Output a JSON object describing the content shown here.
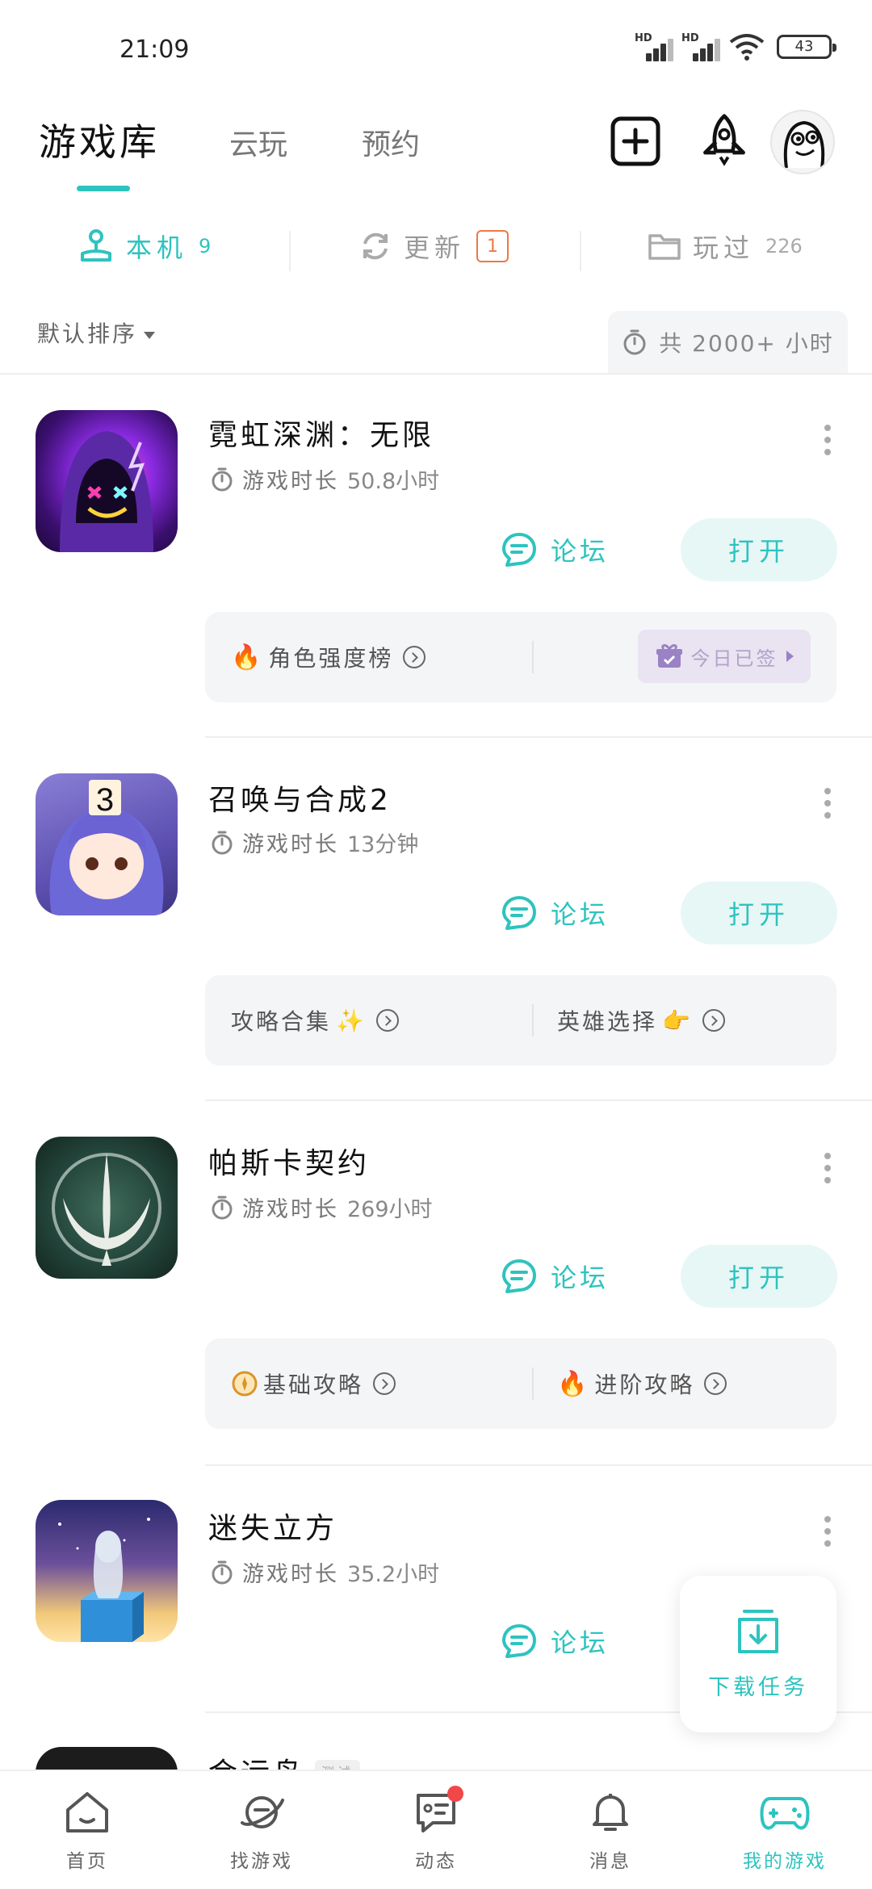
{
  "status_bar": {
    "time": "21:09",
    "battery": "43",
    "signal_label": "HD"
  },
  "top_tabs": [
    {
      "label": "游戏库",
      "active": true
    },
    {
      "label": "云玩",
      "active": false
    },
    {
      "label": "预约",
      "active": false
    }
  ],
  "header_icons": [
    "add-icon",
    "rocket-icon",
    "avatar"
  ],
  "sub_tabs": [
    {
      "label": "本机",
      "count": "9",
      "icon": "joystick-icon",
      "active": true
    },
    {
      "label": "更新",
      "count": "1",
      "icon": "refresh-icon",
      "active": false
    },
    {
      "label": "玩过",
      "count": "226",
      "icon": "folder-icon",
      "active": false
    }
  ],
  "sort": {
    "label": "默认排序"
  },
  "total_time": {
    "text": "共 2000+ 小时"
  },
  "games": [
    {
      "title": "霓虹深渊：无限",
      "time_label": "游戏时长",
      "time_value": "50.8小时",
      "forum_label": "论坛",
      "open_label": "打开",
      "tips": [
        "角色强度榜"
      ],
      "signin_label": "今日已签"
    },
    {
      "title": "召唤与合成2",
      "time_label": "游戏时长",
      "time_value": "13分钟",
      "forum_label": "论坛",
      "open_label": "打开",
      "tips": [
        "攻略合集",
        "英雄选择"
      ]
    },
    {
      "title": "帕斯卡契约",
      "time_label": "游戏时长",
      "time_value": "269小时",
      "forum_label": "论坛",
      "open_label": "打开",
      "tips": [
        "基础攻略",
        "进阶攻略"
      ]
    },
    {
      "title": "迷失立方",
      "time_label": "游戏时长",
      "time_value": "35.2小时",
      "forum_label": "论坛"
    },
    {
      "title": "金运鸟",
      "tag": "测试"
    }
  ],
  "download_task": {
    "label": "下载任务"
  },
  "bottom_nav": [
    {
      "label": "首页",
      "icon": "home-icon",
      "active": false
    },
    {
      "label": "找游戏",
      "icon": "planet-icon",
      "active": false
    },
    {
      "label": "动态",
      "icon": "message-icon",
      "active": false,
      "dot": true
    },
    {
      "label": "消息",
      "icon": "bell-icon",
      "active": false
    },
    {
      "label": "我的游戏",
      "icon": "gamepad-icon",
      "active": true
    }
  ],
  "colors": {
    "accent": "#2ec3bf",
    "badge": "#f07843",
    "dot": "#f04848"
  }
}
